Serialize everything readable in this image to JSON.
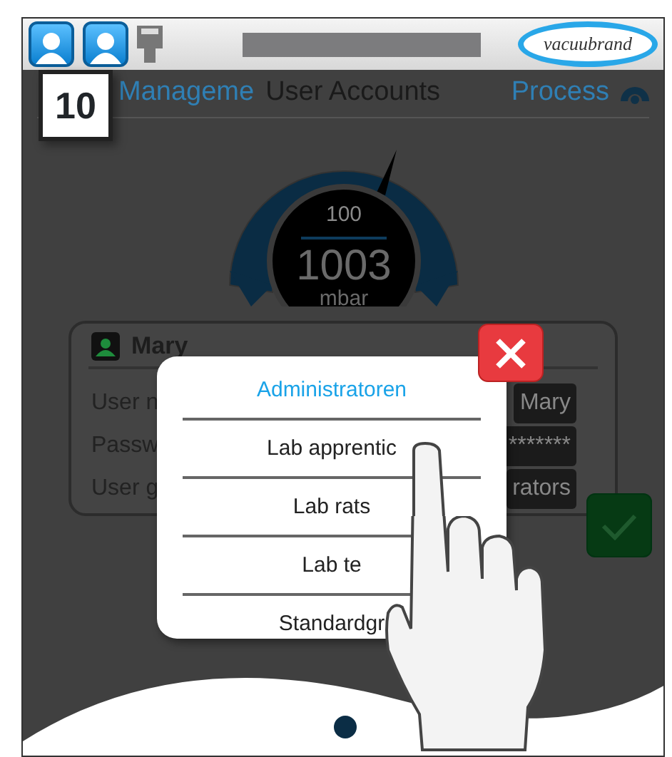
{
  "header": {
    "step_badge": "10",
    "logo": "vacuubrand"
  },
  "nav": {
    "back": "Manageme",
    "title": "User Accounts",
    "forward": "Process"
  },
  "gauge": {
    "setpoint": "100",
    "value": "1003",
    "unit": "mbar"
  },
  "user_card": {
    "name": "Mary",
    "fields": [
      {
        "label": "User n",
        "value": "Mary"
      },
      {
        "label": "Passw",
        "value": "*******"
      },
      {
        "label": "User g",
        "value": "rators"
      }
    ]
  },
  "dropdown": {
    "options": [
      {
        "label": "Administratoren",
        "selected": true
      },
      {
        "label": "Lab apprentic",
        "selected": false
      },
      {
        "label": "Lab rats",
        "selected": false
      },
      {
        "label": "Lab te",
        "selected": false
      },
      {
        "label": "Standardgr",
        "selected": false
      }
    ]
  }
}
